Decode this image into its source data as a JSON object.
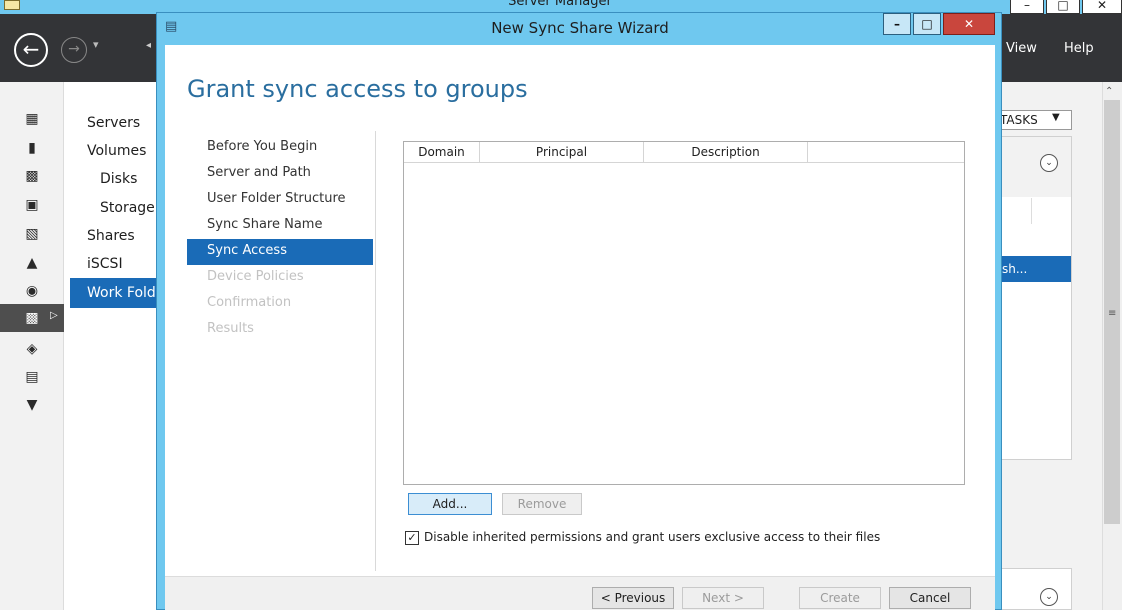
{
  "background": {
    "title": "Server Manager",
    "menu": {
      "view": "View",
      "help": "Help"
    },
    "nav": {
      "back_glyph": "←",
      "forward_glyph": "→",
      "dropdown_glyph": "▾",
      "left_glyph": "◂"
    },
    "window_buttons": {
      "minimize": "–",
      "maximize": "□",
      "close": "✕"
    },
    "sidebar_icons": [
      "dashboard-icon",
      "local-server-icon",
      "all-servers-icon",
      "ad-ds-icon",
      "file-services-icon",
      "iis-icon",
      "print-services-icon",
      "file-storage-icon",
      "remote-access-icon",
      "wsus-icon",
      "hyper-v-icon"
    ],
    "sidebar_selected_arrow": "▷",
    "subnav": [
      {
        "label": "Servers"
      },
      {
        "label": "Volumes"
      },
      {
        "label": "Disks"
      },
      {
        "label": "Storage"
      },
      {
        "label": "Shares"
      },
      {
        "label": "iSCSI"
      },
      {
        "label": "Work Fold"
      }
    ],
    "tasks_label": "TASKS",
    "tasks_arrow": "▼",
    "chevron": "⌄",
    "selected_row_text": "sh...",
    "scroll_up": "⌃",
    "scroll_grip": "≡"
  },
  "wizard": {
    "title": "New Sync Share Wizard",
    "window_buttons": {
      "minimize": "–",
      "maximize": "□",
      "close": "✕"
    },
    "heading": "Grant sync access to groups",
    "steps": [
      {
        "label": "Before You Begin",
        "state": "done"
      },
      {
        "label": "Server and Path",
        "state": "done"
      },
      {
        "label": "User Folder Structure",
        "state": "done"
      },
      {
        "label": "Sync Share Name",
        "state": "done"
      },
      {
        "label": "Sync Access",
        "state": "current"
      },
      {
        "label": "Device Policies",
        "state": "pending"
      },
      {
        "label": "Confirmation",
        "state": "pending"
      },
      {
        "label": "Results",
        "state": "pending"
      }
    ],
    "grid": {
      "columns": [
        "Domain",
        "Principal",
        "Description"
      ],
      "rows": []
    },
    "buttons": {
      "add": "Add...",
      "remove": "Remove",
      "previous": "< Previous",
      "next": "Next >",
      "create": "Create",
      "cancel": "Cancel"
    },
    "checkbox": {
      "checked": true,
      "mark": "✓",
      "label": "Disable inherited permissions and grant users exclusive access to their files"
    }
  }
}
